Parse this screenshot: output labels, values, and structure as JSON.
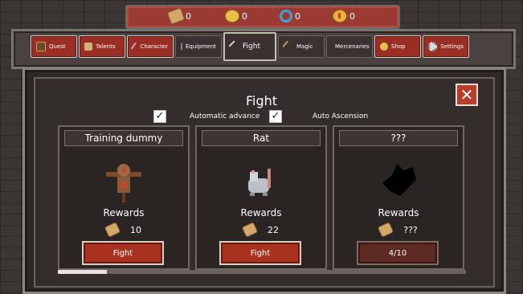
{
  "resources": [
    {
      "icon": "scroll-icon",
      "value": "0"
    },
    {
      "icon": "coin-icon",
      "value": "0"
    },
    {
      "icon": "swirl-icon",
      "value": "0"
    },
    {
      "icon": "gem-coin-icon",
      "value": "0"
    }
  ],
  "nav": {
    "tabs": [
      {
        "label": "Quest",
        "style": "red"
      },
      {
        "label": "Talents",
        "style": "red"
      },
      {
        "label": "Character",
        "style": "red"
      },
      {
        "label": "Equipment",
        "style": "dark"
      },
      {
        "label": "Fight",
        "style": "active"
      },
      {
        "label": "Magic",
        "style": "dark"
      },
      {
        "label": "Mercenaries",
        "style": "dark"
      },
      {
        "label": "Shop",
        "style": "red"
      },
      {
        "label": "Settings",
        "style": "red"
      }
    ]
  },
  "panel": {
    "title": "Fight",
    "options": [
      {
        "label": "Automatic advance",
        "checked": true
      },
      {
        "label": "Auto Ascension",
        "checked": true
      }
    ]
  },
  "enemies": [
    {
      "name": "Training dummy",
      "rewards_label": "Rewards",
      "reward_value": "10",
      "button_label": "Fight",
      "locked": false
    },
    {
      "name": "Rat",
      "rewards_label": "Rewards",
      "reward_value": "22",
      "button_label": "Fight",
      "locked": false
    },
    {
      "name": "???",
      "rewards_label": "Rewards",
      "reward_value": "???",
      "button_label": "4/10",
      "locked": true
    }
  ],
  "progress": 0.12
}
